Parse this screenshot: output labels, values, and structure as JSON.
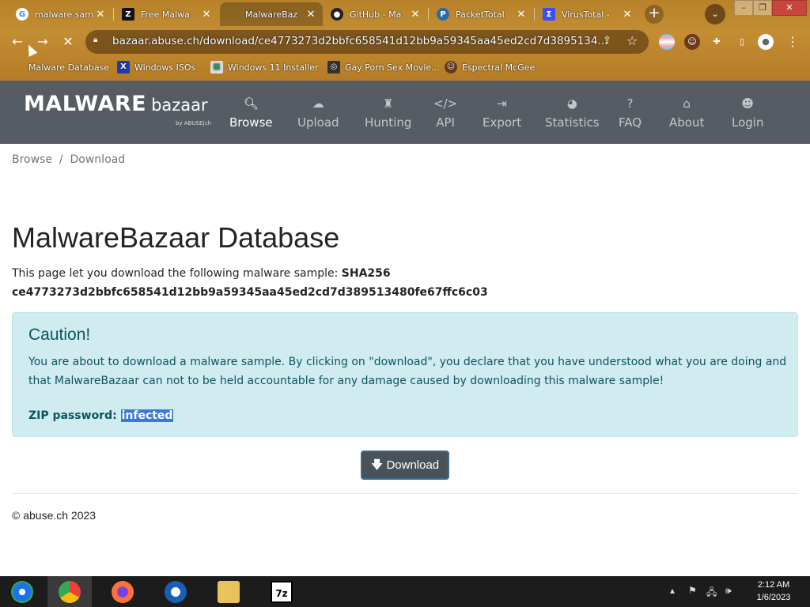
{
  "browser": {
    "tabs": [
      {
        "title": "malware sam",
        "icon": "google-icon",
        "active": false
      },
      {
        "title": "Free Malwa",
        "icon": "zeltser-icon",
        "active": false
      },
      {
        "title": "MalwareBaz",
        "icon": "loading-icon",
        "active": true
      },
      {
        "title": "GitHub - Ma",
        "icon": "github-icon",
        "active": false
      },
      {
        "title": "PacketTotal",
        "icon": "packettotal-icon",
        "active": false
      },
      {
        "title": "VirusTotal -",
        "icon": "virustotal-icon",
        "active": false
      }
    ],
    "url": "bazaar.abuse.ch/download/ce4773273d2bbfc658541d12bb9a59345aa45ed2cd7d3895134...",
    "bookmarks": [
      {
        "label": "Malware Database",
        "icon": "bookmark-icon"
      },
      {
        "label": "Windows ISOs",
        "icon": "x-icon"
      },
      {
        "label": "Windows 11 Installer",
        "icon": "installer-icon"
      },
      {
        "label": "Gay Porn Sex Movie...",
        "icon": "bookmark-site-icon"
      },
      {
        "label": "Espectral McGee",
        "icon": "avatar-icon"
      }
    ]
  },
  "site": {
    "logo_main": "MALWARE",
    "logo_sub": "bazaar",
    "logo_byline": "by ABUSE|ch",
    "nav": [
      {
        "label": "Browse",
        "icon": "search-icon",
        "active": true
      },
      {
        "label": "Upload",
        "icon": "cloud-upload-icon",
        "active": false
      },
      {
        "label": "Hunting",
        "icon": "chess-rook-icon",
        "active": false
      },
      {
        "label": "API",
        "icon": "code-icon",
        "active": false
      },
      {
        "label": "Export",
        "icon": "file-export-icon",
        "active": false
      },
      {
        "label": "Statistics",
        "icon": "pie-chart-icon",
        "active": false
      },
      {
        "label": "FAQ",
        "icon": "question-icon",
        "active": false
      },
      {
        "label": "About",
        "icon": "building-icon",
        "active": false
      },
      {
        "label": "Login",
        "icon": "user-icon",
        "active": false
      }
    ]
  },
  "breadcrumb": {
    "first": "Browse",
    "sep": "/",
    "current": "Download"
  },
  "page": {
    "title": "MalwareBazaar Database",
    "intro": "This page let you download the following malware sample:",
    "hash_label": "SHA256",
    "hash": "ce4773273d2bbfc658541d12bb9a59345aa45ed2cd7d389513480fe67ffc6c03"
  },
  "alert": {
    "title": "Caution!",
    "message": "You are about to download a malware sample. By clicking on \"download\", you declare that you have understood what you are doing and that MalwareBazaar can not to be held accountable for any damage caused by downloading this malware sample!",
    "password_label": "ZIP password:",
    "password_value": "infected"
  },
  "download_label": "Download",
  "footer": "© abuse.ch 2023",
  "taskbar": {
    "time": "2:12 AM",
    "date": "1/6/2023"
  }
}
